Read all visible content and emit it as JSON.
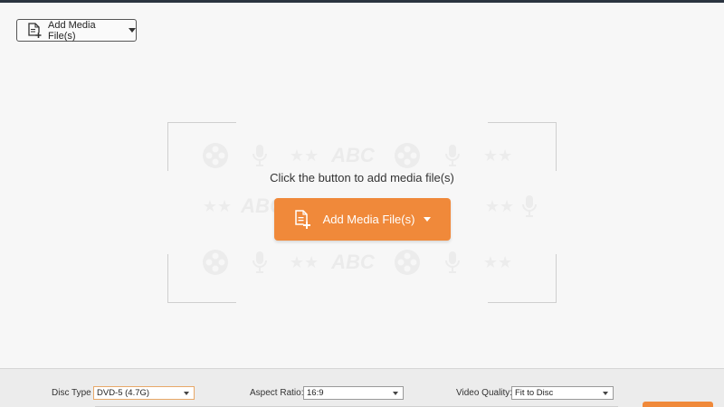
{
  "toolbar": {
    "add_label": "Add Media File(s)"
  },
  "drop_zone": {
    "hint": "Click the button to add media file(s)",
    "add_button_label": "Add Media File(s)",
    "watermark_text": "ABC"
  },
  "settings": {
    "disc_type": {
      "label": "Disc Type",
      "value": "DVD-5 (4.7G)"
    },
    "aspect_ratio": {
      "label": "Aspect Ratio:",
      "value": "16:9"
    },
    "video_quality": {
      "label": "Video Quality:",
      "value": "Fit to Disc"
    }
  },
  "colors": {
    "accent": "#f0893a",
    "top_bar": "#2b3440"
  },
  "icons": [
    "add-file-icon",
    "chevron-down-icon",
    "film-reel-icon",
    "microphone-icon",
    "stars-icon"
  ]
}
